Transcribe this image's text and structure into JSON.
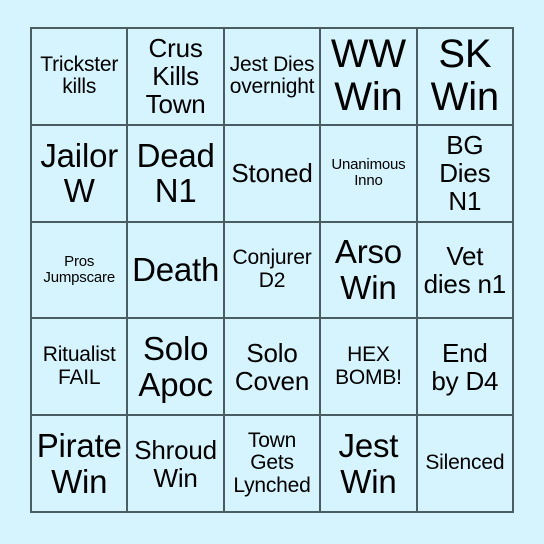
{
  "card": {
    "name": "bingo-card",
    "background_color": "#d6f4fd",
    "border_color": "#4a5d63",
    "text_color": "#000000",
    "columns": 5,
    "rows": 5,
    "cells": [
      [
        {
          "text": "Trickster\nkills",
          "size": "sm"
        },
        {
          "text": "Crus\nKills\nTown",
          "size": "md"
        },
        {
          "text": "Jest Dies\novernight",
          "size": "sm"
        },
        {
          "text": "WW\nWin",
          "size": "xl"
        },
        {
          "text": "SK\nWin",
          "size": "xl"
        }
      ],
      [
        {
          "text": "Jailor\nW",
          "size": "lg"
        },
        {
          "text": "Dead\nN1",
          "size": "lg"
        },
        {
          "text": "Stoned",
          "size": "md"
        },
        {
          "text": "Unanimous\nInno",
          "size": "xs"
        },
        {
          "text": "BG\nDies\nN1",
          "size": "md"
        }
      ],
      [
        {
          "text": "Pros\nJumpscare",
          "size": "xs"
        },
        {
          "text": "Death",
          "size": "lg"
        },
        {
          "text": "Conjurer\nD2",
          "size": "sm"
        },
        {
          "text": "Arso\nWin",
          "size": "lg"
        },
        {
          "text": "Vet\ndies n1",
          "size": "md"
        }
      ],
      [
        {
          "text": "Ritualist\nFAIL",
          "size": "sm"
        },
        {
          "text": "Solo\nApoc",
          "size": "lg"
        },
        {
          "text": "Solo\nCoven",
          "size": "md"
        },
        {
          "text": "HEX\nBOMB!",
          "size": "sm"
        },
        {
          "text": "End\nby D4",
          "size": "md"
        }
      ],
      [
        {
          "text": "Pirate\nWin",
          "size": "lg"
        },
        {
          "text": "Shroud\nWin",
          "size": "md"
        },
        {
          "text": "Town\nGets\nLynched",
          "size": "sm"
        },
        {
          "text": "Jest\nWin",
          "size": "lg"
        },
        {
          "text": "Silenced",
          "size": "sm"
        }
      ]
    ]
  }
}
